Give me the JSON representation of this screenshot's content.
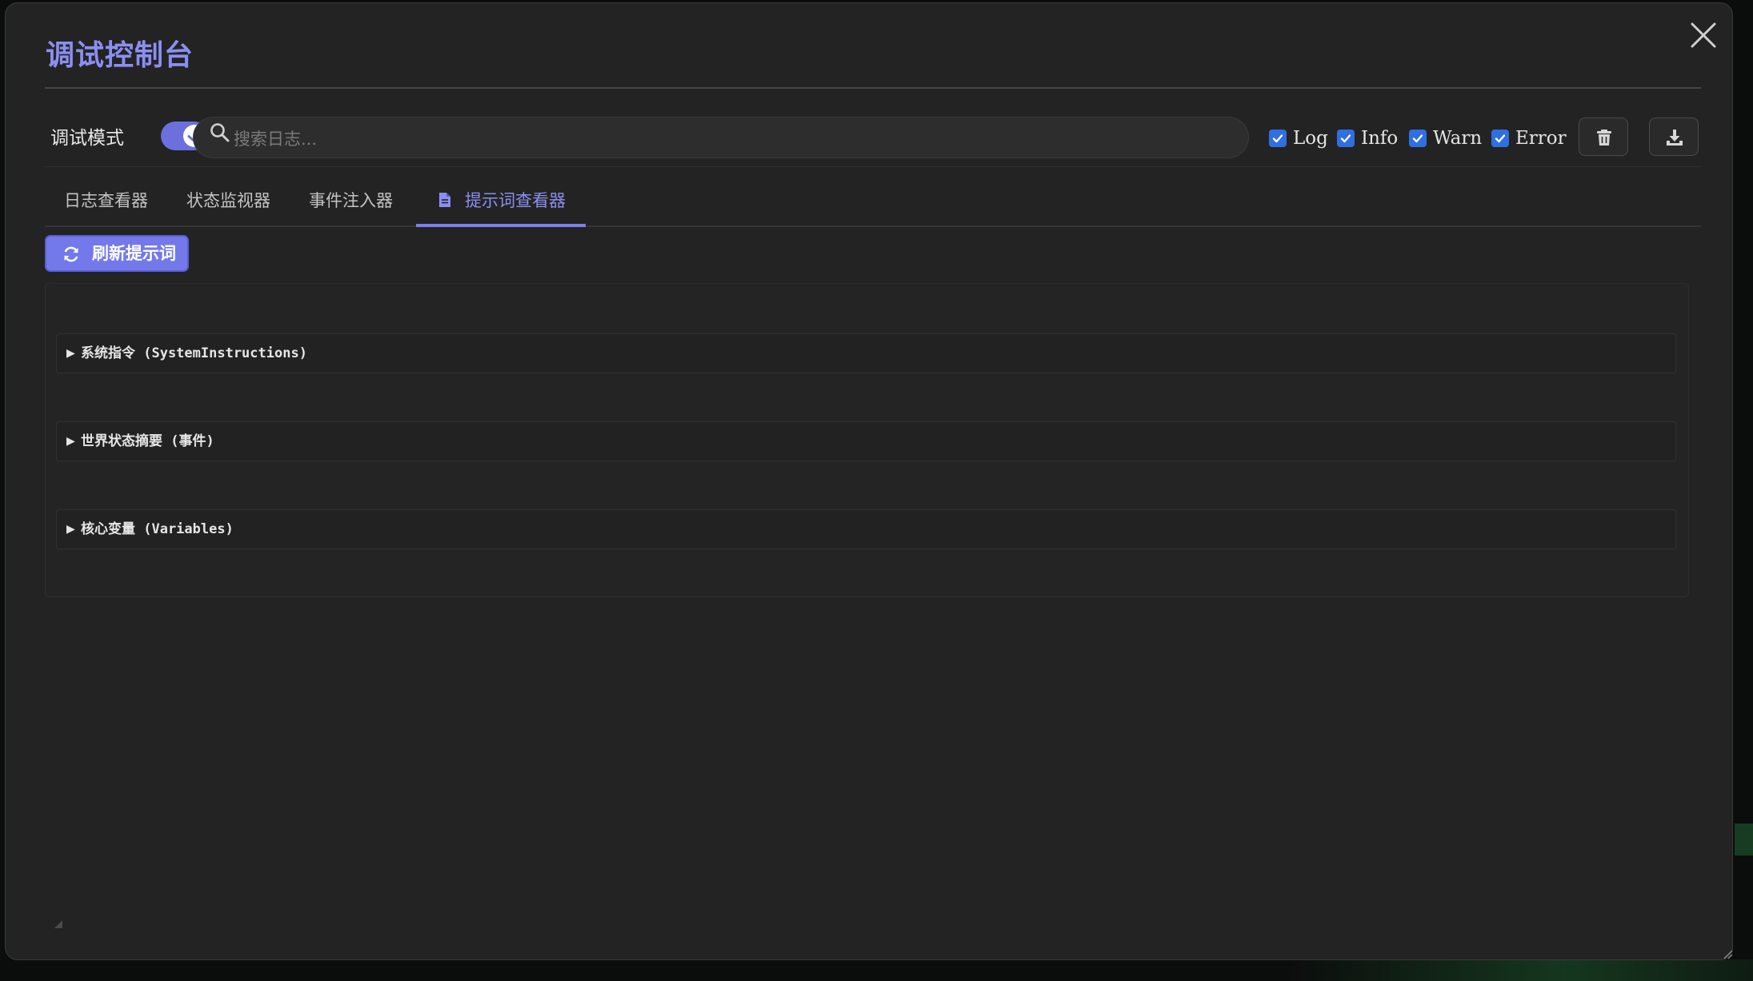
{
  "modal": {
    "title": "调试控制台"
  },
  "toolbar": {
    "debug_mode_label": "调试模式",
    "debug_mode_on": true,
    "search_placeholder": "搜索日志...",
    "search_value": "",
    "filters": [
      {
        "label": "Log",
        "checked": true
      },
      {
        "label": "Info",
        "checked": true
      },
      {
        "label": "Warn",
        "checked": true
      },
      {
        "label": "Error",
        "checked": true
      }
    ],
    "clear_icon": "trash-icon",
    "export_icon": "download-icon"
  },
  "tabs": [
    {
      "label": "日志查看器",
      "active": false
    },
    {
      "label": "状态监视器",
      "active": false
    },
    {
      "label": "事件注入器",
      "active": false
    },
    {
      "label": "提示词查看器",
      "active": true,
      "icon": "file-icon"
    }
  ],
  "prompt_viewer": {
    "refresh_label": "刷新提示词",
    "refresh_icon": "refresh-icon",
    "sections": [
      {
        "label": "系统指令 (SystemInstructions)",
        "expanded": false
      },
      {
        "label": "世界状态摘要 (事件)",
        "expanded": false
      },
      {
        "label": "核心变量 (Variables)",
        "expanded": false
      }
    ]
  },
  "colors": {
    "accent": "#8b8ff2",
    "button": "#7378ea",
    "checkbox": "#2f6fe0",
    "panel_bg": "#232323"
  }
}
